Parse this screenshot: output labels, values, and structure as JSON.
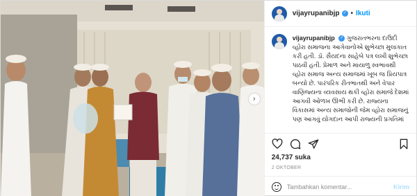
{
  "post": {
    "username": "vijayrupanibjp",
    "follow_label": "Ikuti",
    "separator": "•",
    "verified_mark": "✓",
    "caption_text": "ગુજરાતભરના દાઉદી વ્હોરા સમાજના આગેવાનોએ શુભેચ્છા મુલાકાત કરી હતી. ડૉ. સૈયદના સાહેબે પત્ર લખી શુભેચ્છા પાઠવી હતી. પ્રેમાળ અને માયાળુ સ્વભાવથી વ્હોરા સમાજ અન્ય સમાજમાં ખૂબ જ પ્રિયપાત્ર બન્યો છે. પારંપરિક રીતભાતથી અને વેપાર વાણિજ્યના વ્યવસાય થકી વ્હોરા સમાજે દેશમાં આગવી ઓળખ ઊભી કરી છે. રાજ્યના વિકાસમાં અન્ય સમાજોની જેમ વ્હોરા સમાજનું પણ આગવું યોગદાન આપી રાજ્યની પ્રગતિમાં અનન્ય ભાગીદારી કરી સમાજે ગૌરવ વધાર્યું છે.",
    "likes": "24,737 suka",
    "date": "2 OKTOBER",
    "comment_placeholder": "Tambahkan komentar...",
    "post_button": "Kirim"
  },
  "icons": {
    "like": "heart-icon",
    "comment": "comment-icon",
    "share": "send-icon",
    "save": "bookmark-icon",
    "emoji": "emoji-icon",
    "next": "chevron-right-icon"
  },
  "colors": {
    "link_blue": "#0095f6",
    "verified_blue": "#3897f0",
    "muted": "#8e8e8e",
    "disabled_button": "#b2dffc"
  },
  "carousel": {
    "next_symbol": "›"
  }
}
